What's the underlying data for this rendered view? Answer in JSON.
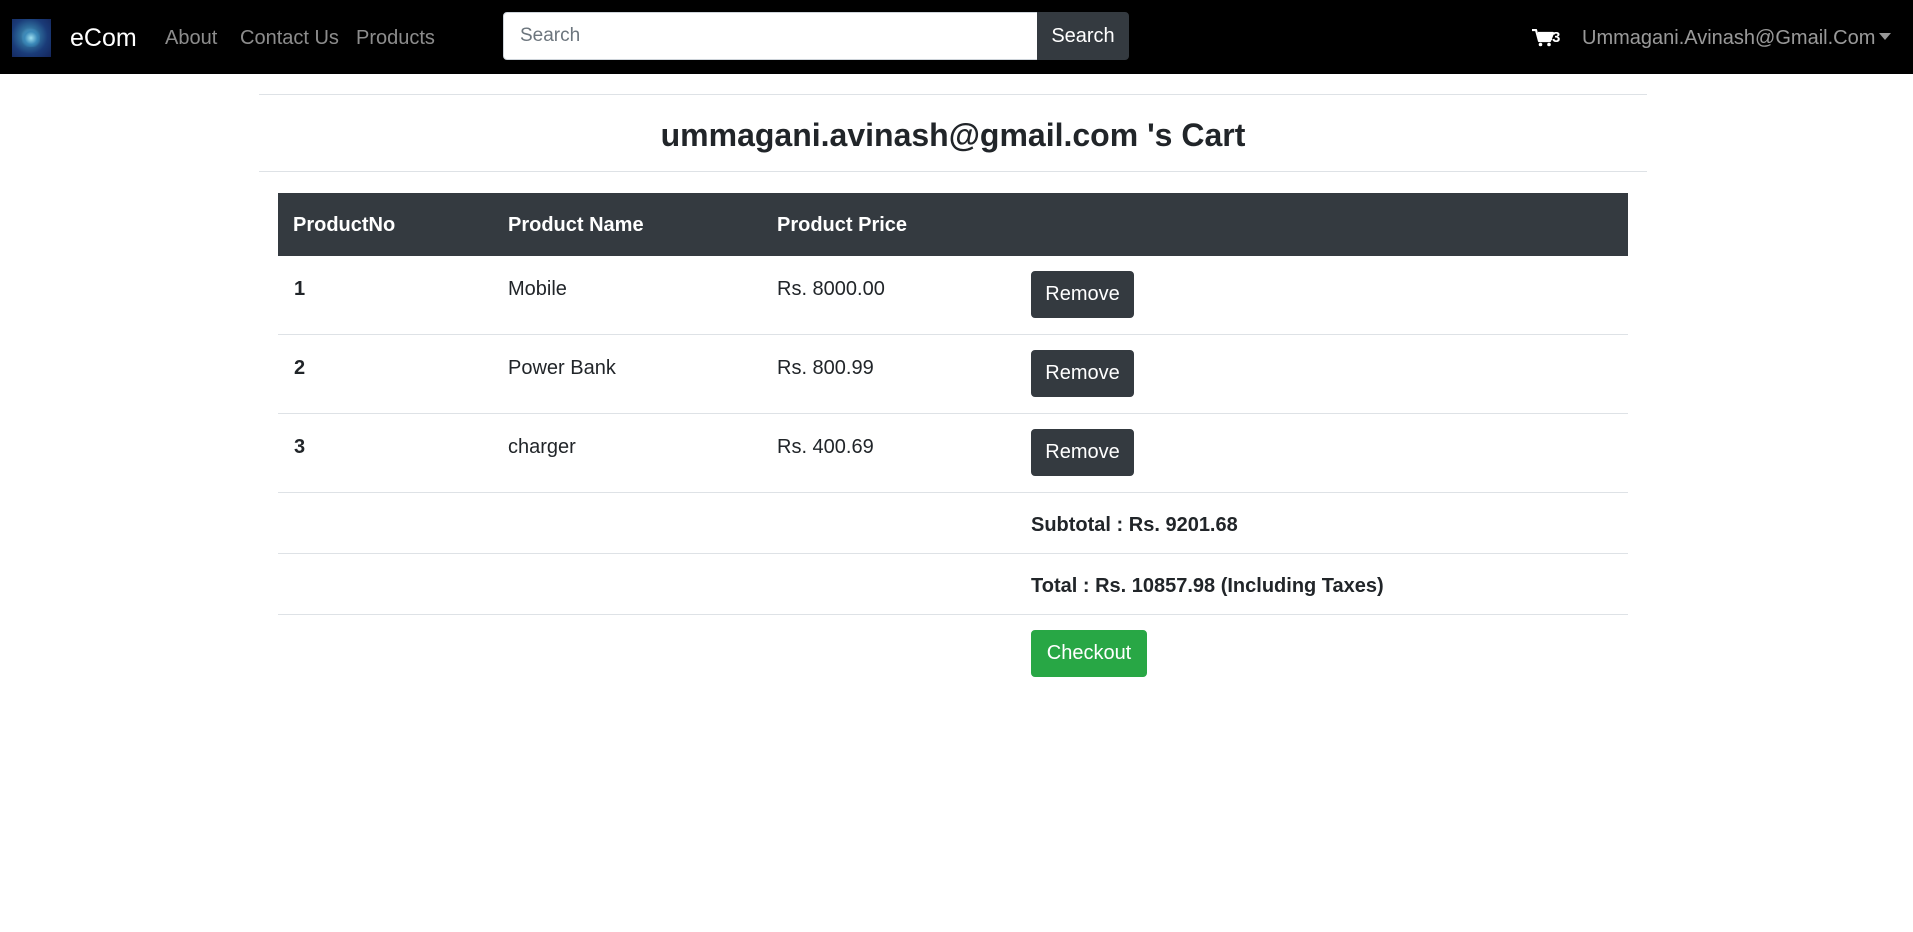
{
  "navbar": {
    "brand": "eCom",
    "links": [
      "About",
      "Contact Us",
      "Products"
    ],
    "search": {
      "placeholder": "Search",
      "value": "",
      "button_label": "Search"
    },
    "cart_count": "3",
    "user": "Ummagani.Avinash@Gmail.Com"
  },
  "cart": {
    "title": "ummagani.avinash@gmail.com 's Cart",
    "columns": [
      "ProductNo",
      "Product Name",
      "Product Price"
    ],
    "rows": [
      {
        "no": "1",
        "name": "Mobile",
        "price": "Rs. 8000.00",
        "action": "Remove"
      },
      {
        "no": "2",
        "name": "Power Bank",
        "price": "Rs. 800.99",
        "action": "Remove"
      },
      {
        "no": "3",
        "name": "charger",
        "price": "Rs. 400.69",
        "action": "Remove"
      }
    ],
    "subtotal": "Subtotal : Rs. 9201.68",
    "total": "Total : Rs. 10857.98 (Including Taxes)",
    "checkout_label": "Checkout"
  },
  "colors": {
    "navbar_bg": "#000000",
    "dark_button": "#343a40",
    "success_button": "#28a745"
  },
  "icons": {
    "logo": "brand-logo-image",
    "cart": "shopping-cart-icon",
    "dropdown": "caret-down-icon"
  }
}
